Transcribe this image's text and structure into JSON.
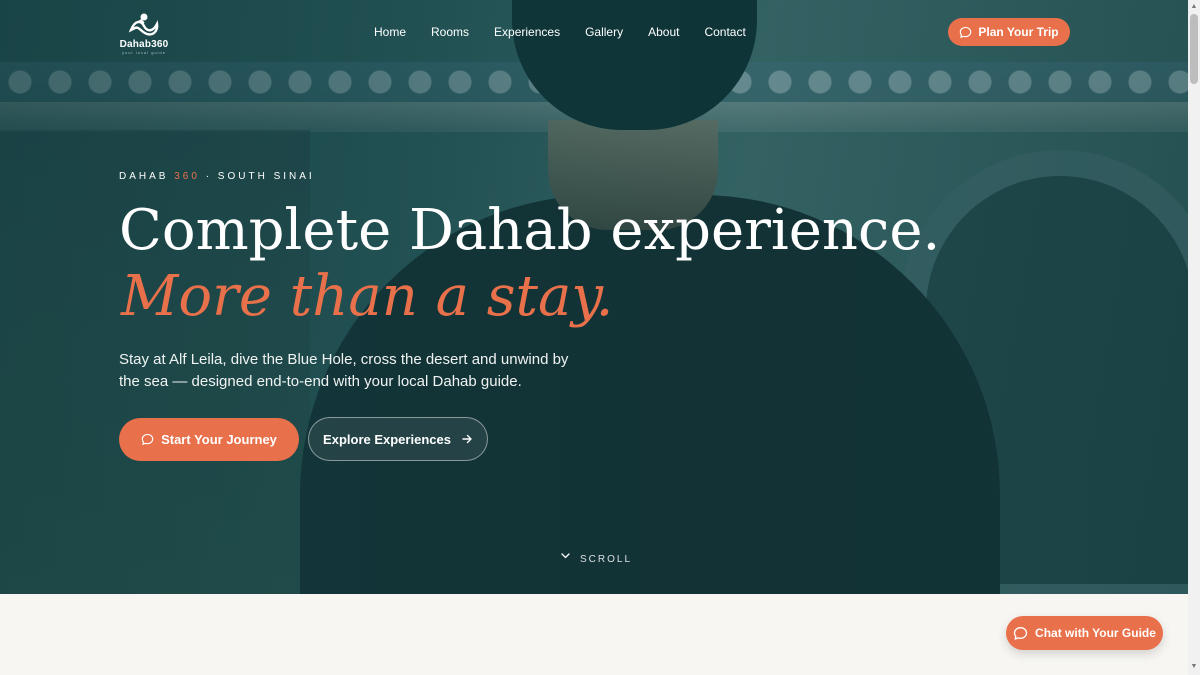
{
  "brand": {
    "name": "Dahab360",
    "tagline": "your local guide"
  },
  "nav": {
    "items": [
      "Home",
      "Rooms",
      "Experiences",
      "Gallery",
      "About",
      "Contact"
    ],
    "cta_label": "Plan Your Trip"
  },
  "hero": {
    "eyebrow_prefix": "DAHAB",
    "eyebrow_accent": "360",
    "eyebrow_suffix": "· SOUTH SINAI",
    "headline": "Complete Dahab experience.",
    "headline_accent": "More than a stay.",
    "lede": "Stay at Alf Leila, dive the Blue Hole, cross the desert and unwind by the sea — designed end-to-end with your local Dahab guide.",
    "primary_cta": "Start Your Journey",
    "secondary_cta": "Explore Experiences",
    "scroll_label": "SCROLL"
  },
  "chat": {
    "label": "Chat with Your Guide"
  },
  "colors": {
    "accent": "#e8704a",
    "hero_overlay": "#1f4f52",
    "page_bg": "#f7f6f3"
  },
  "icons": {
    "chat": "chat-bubble-icon",
    "arrow": "arrow-right-icon",
    "chevron": "chevron-down-icon"
  }
}
